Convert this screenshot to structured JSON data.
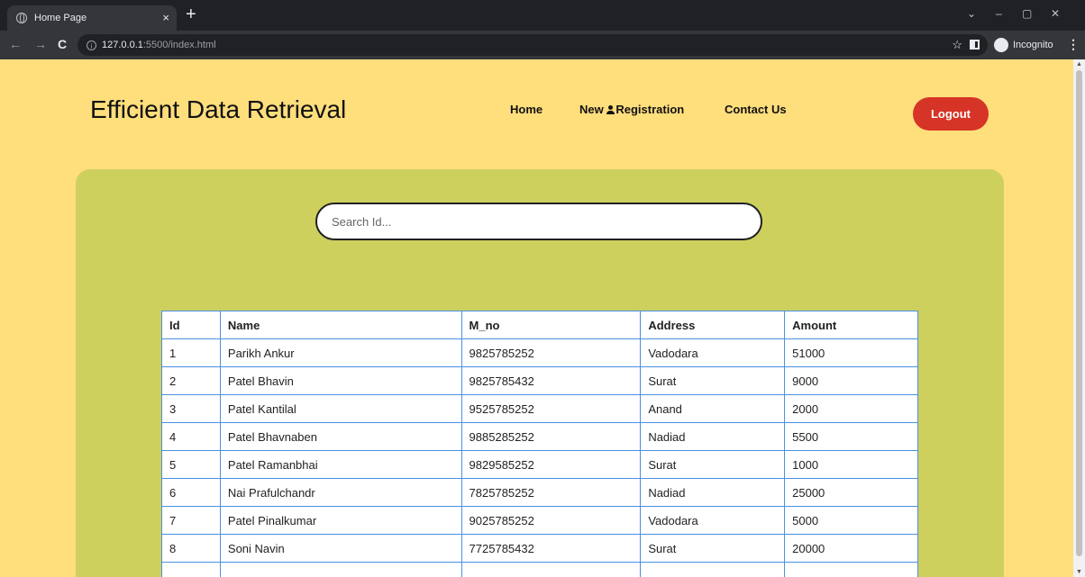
{
  "browser": {
    "tab_title": "Home Page",
    "tab_close": "×",
    "new_tab": "+",
    "url_host": "127.0.0.1",
    "url_path": ":5500/index.html",
    "incognito_label": "Incognito",
    "window_controls": [
      "⌄",
      "–",
      "▢",
      "✕"
    ]
  },
  "header": {
    "site_title": "Efficient Data Retrieval",
    "nav": {
      "home": "Home",
      "new_prefix": "New",
      "registration": "Registration",
      "contact": "Contact Us"
    },
    "logout_label": "Logout"
  },
  "search": {
    "placeholder": "Search Id..."
  },
  "table": {
    "headers": [
      "Id",
      "Name",
      "M_no",
      "Address",
      "Amount"
    ],
    "rows": [
      [
        "1",
        "Parikh Ankur",
        "9825785252",
        "Vadodara",
        "51000"
      ],
      [
        "2",
        "Patel Bhavin",
        "9825785432",
        "Surat",
        "9000"
      ],
      [
        "3",
        "Patel Kantilal",
        "9525785252",
        "Anand",
        "2000"
      ],
      [
        "4",
        "Patel Bhavnaben",
        "9885285252",
        "Nadiad",
        "5500"
      ],
      [
        "5",
        "Patel Ramanbhai",
        "9829585252",
        "Surat",
        "1000"
      ],
      [
        "6",
        "Nai Prafulchandr",
        "7825785252",
        "Nadiad",
        "25000"
      ],
      [
        "7",
        "Patel Pinalkumar",
        "9025785252",
        "Vadodara",
        "5000"
      ],
      [
        "8",
        "Soni Navin",
        "7725785432",
        "Surat",
        "20000"
      ]
    ]
  },
  "colors": {
    "page_bg": "#ffde7c",
    "panel_bg": "#ced05e",
    "logout_bg": "#d63427",
    "table_border": "#4a90e2"
  }
}
